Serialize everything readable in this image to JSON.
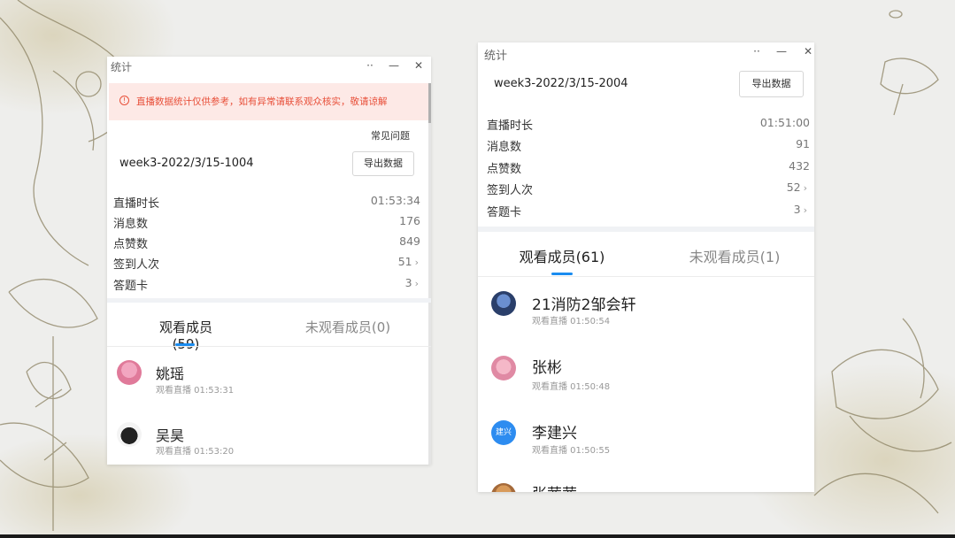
{
  "window_left": {
    "title": "统计",
    "alert_icon": "!",
    "alert": "直播数据统计仅供参考，如有异常请联系观众核实，敬请谅解",
    "faq": "常见问题",
    "session": "week3-2022/3/15-1004",
    "export": "导出数据",
    "stats": [
      {
        "label": "直播时长",
        "value": "01:53:34",
        "chevron": ""
      },
      {
        "label": "消息数",
        "value": "176",
        "chevron": ""
      },
      {
        "label": "点赞数",
        "value": "849",
        "chevron": ""
      },
      {
        "label": "签到人次",
        "value": "51",
        "chevron": "›"
      },
      {
        "label": "答题卡",
        "value": "3",
        "chevron": "›"
      }
    ],
    "tabs": {
      "watched": "观看成员(59)",
      "unwatched": "未观看成员(0)"
    },
    "members": [
      {
        "name": "姚瑶",
        "sub": "观看直播 01:53:31"
      },
      {
        "name": "吴昊",
        "sub": "观看直播 01:53:20"
      }
    ]
  },
  "window_right": {
    "title": "统计",
    "session": "week3-2022/3/15-2004",
    "export": "导出数据",
    "stats": [
      {
        "label": "直播时长",
        "value": "01:51:00",
        "chevron": ""
      },
      {
        "label": "消息数",
        "value": "91",
        "chevron": ""
      },
      {
        "label": "点赞数",
        "value": "432",
        "chevron": ""
      },
      {
        "label": "签到人次",
        "value": "52",
        "chevron": "›"
      },
      {
        "label": "答题卡",
        "value": "3",
        "chevron": "›"
      }
    ],
    "tabs": {
      "watched": "观看成员(61)",
      "unwatched": "未观看成员(1)"
    },
    "members": [
      {
        "name": "21消防2邹会轩",
        "sub": "观看直播 01:50:54"
      },
      {
        "name": "张彬",
        "sub": "观看直播 01:50:48"
      },
      {
        "name": "李建兴",
        "sub": "观看直播 01:50:55",
        "avatar_text": "建兴"
      },
      {
        "name": "张茜茜",
        "sub": ""
      }
    ]
  },
  "titlebar_icons": {
    "more": "more-icon",
    "minimize": "minimize-icon",
    "close": "close-icon"
  },
  "colors": {
    "accent": "#1a8cf0",
    "alert_text": "#e8503a",
    "alert_bg": "#fde9e6"
  }
}
